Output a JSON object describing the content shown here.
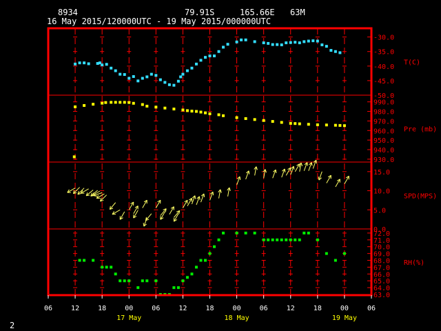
{
  "header": {
    "station": "8934",
    "lat": "79.91S",
    "lon": "165.66E",
    "elev": "63M",
    "period": "16 May 2015/120000UTC - 19 May 2015/000000UTC"
  },
  "footer_page": "2",
  "colors": {
    "frame": "#ff0000",
    "tick": "#ff0000",
    "axis_text": "#ff0000",
    "date_text": "#ffff00",
    "temperature": "#33ddff",
    "pressure": "#ffff00",
    "wind": "#ffff66",
    "humidity": "#00ee00"
  },
  "x_axis": {
    "range_hours": [
      -6,
      66
    ],
    "ticks": [
      {
        "h": -6,
        "label": "06"
      },
      {
        "h": 0,
        "label": "12"
      },
      {
        "h": 6,
        "label": "18"
      },
      {
        "h": 12,
        "label": "00"
      },
      {
        "h": 18,
        "label": "06"
      },
      {
        "h": 24,
        "label": "12"
      },
      {
        "h": 30,
        "label": "18"
      },
      {
        "h": 36,
        "label": "00"
      },
      {
        "h": 42,
        "label": "06"
      },
      {
        "h": 48,
        "label": "12"
      },
      {
        "h": 54,
        "label": "18"
      },
      {
        "h": 60,
        "label": "00"
      },
      {
        "h": 66,
        "label": "06"
      }
    ],
    "dates": [
      {
        "h": 12,
        "label": "17 May"
      },
      {
        "h": 36,
        "label": "18 May"
      },
      {
        "h": 60,
        "label": "19 May"
      }
    ]
  },
  "chart_data": [
    {
      "type": "scatter",
      "panel": "temperature",
      "ylabel": "T(C)",
      "ylim": [
        -50,
        -27
      ],
      "yticks": [
        -30.0,
        -35.0,
        -40.0,
        -45.0,
        -50.0
      ],
      "x": [
        0,
        1,
        2,
        3,
        5,
        5.5,
        6,
        7,
        8,
        9,
        10,
        11,
        12,
        13,
        14,
        15,
        16,
        17,
        18,
        19,
        20,
        21,
        22,
        23,
        23.5,
        24,
        25,
        26,
        27,
        28,
        29,
        30,
        31,
        32,
        33,
        34,
        36,
        37,
        38,
        40,
        42,
        43,
        44,
        45,
        46,
        47,
        48,
        49,
        50,
        51,
        52,
        53,
        54,
        55,
        56,
        57,
        58,
        59
      ],
      "y": [
        -39.3,
        -38.9,
        -38.9,
        -39.2,
        -39.1,
        -38.9,
        -39.6,
        -39.4,
        -40.7,
        -41.6,
        -42.8,
        -42.9,
        -44.2,
        -43.6,
        -45.1,
        -44.2,
        -43.7,
        -42.8,
        -43.2,
        -44.7,
        -45.6,
        -46.4,
        -46.6,
        -45.2,
        -43.7,
        -42.8,
        -41.6,
        -40.7,
        -39.3,
        -38.0,
        -37.0,
        -36.5,
        -36.5,
        -35.0,
        -33.5,
        -32.5,
        -31.7,
        -31.0,
        -31.0,
        -31.6,
        -32.0,
        -32.2,
        -32.6,
        -32.6,
        -32.7,
        -32.0,
        -31.9,
        -31.8,
        -32.0,
        -31.6,
        -31.4,
        -31.3,
        -31.4,
        -32.7,
        -33.2,
        -34.6,
        -35.0,
        -35.4
      ]
    },
    {
      "type": "scatter",
      "panel": "pressure",
      "ylabel": "Pre (mb)",
      "ylim": [
        927,
        997
      ],
      "yticks": [
        990.0,
        980.0,
        970.0,
        960.0,
        950.0,
        940.0,
        930.0
      ],
      "x": [
        -0.2,
        0,
        2,
        4,
        6,
        6.8,
        8,
        9,
        10,
        11,
        12,
        13,
        15,
        16,
        18,
        20,
        22,
        24,
        25,
        26,
        27,
        28,
        29,
        30,
        32,
        33,
        36,
        38,
        40,
        42,
        44,
        46,
        48,
        49,
        50,
        52,
        54,
        56,
        58,
        59,
        60
      ],
      "y": [
        932.5,
        984.8,
        986.2,
        987.5,
        988.6,
        989.3,
        989.5,
        989.5,
        989.5,
        989.5,
        989.3,
        988.5,
        987.2,
        985.5,
        984.5,
        983.5,
        982.5,
        981.5,
        980.8,
        980.3,
        980.0,
        979.3,
        978.5,
        977.5,
        976.5,
        975.5,
        973.5,
        972.5,
        971.5,
        970.5,
        969.5,
        968.5,
        967.5,
        967.3,
        967.0,
        966.5,
        966.0,
        965.8,
        965.5,
        965.3,
        965.1
      ]
    },
    {
      "type": "vector",
      "panel": "wind",
      "ylabel": "SPD(MPS)",
      "ylim": [
        0,
        17.5
      ],
      "yticks": [
        15.0,
        10.0,
        5.0,
        0.0
      ],
      "x": [
        0,
        1,
        2,
        3,
        4,
        5,
        5.5,
        6,
        6.5,
        7,
        9,
        10,
        11,
        12,
        13,
        14,
        15,
        16,
        17,
        18,
        19,
        20,
        21,
        22,
        23,
        24,
        25,
        26,
        27,
        28,
        30,
        32,
        34,
        36,
        38,
        40,
        42,
        44,
        46,
        47,
        48,
        49,
        50,
        51,
        52,
        53,
        55,
        56,
        58,
        60
      ],
      "y": [
        10.7,
        10.9,
        10.7,
        10.5,
        10.2,
        10.1,
        9.9,
        9.5,
        9.2,
        8.9,
        6.9,
        5.0,
        4.5,
        5.0,
        4.0,
        4.9,
        5.5,
        2.9,
        4.0,
        5.5,
        3.5,
        4.5,
        3.8,
        3.0,
        4.0,
        5.5,
        6.0,
        6.5,
        6.3,
        7.0,
        7.5,
        8.0,
        8.5,
        11.5,
        13.0,
        14.0,
        13.3,
        13.3,
        13.5,
        14.0,
        14.2,
        15.0,
        15.0,
        15.2,
        15.2,
        15.8,
        15.0,
        12.0,
        11.0,
        11.8
      ],
      "dir_deg": [
        240,
        225,
        225,
        240,
        230,
        230,
        240,
        250,
        240,
        225,
        220,
        240,
        210,
        30,
        30,
        210,
        30,
        200,
        220,
        30,
        40,
        210,
        30,
        40,
        210,
        30,
        30,
        20,
        20,
        20,
        20,
        10,
        10,
        20,
        20,
        10,
        10,
        20,
        20,
        30,
        20,
        30,
        10,
        20,
        20,
        20,
        200,
        30,
        30,
        30
      ]
    },
    {
      "type": "scatter",
      "panel": "humidity",
      "ylabel": "RH(%)",
      "ylim": [
        62.9,
        72.6
      ],
      "yticks": [
        72.0,
        71.0,
        70.0,
        69.0,
        68.0,
        67.0,
        66.0,
        65.0,
        64.0,
        63.0
      ],
      "x": [
        1,
        2,
        4,
        6,
        7,
        8,
        9,
        10,
        11,
        12,
        14,
        15,
        16,
        18,
        19,
        20,
        21,
        22,
        23,
        24,
        25,
        26,
        27,
        28,
        29,
        30,
        31,
        32,
        33,
        36,
        38,
        40,
        42,
        43,
        44,
        45,
        46,
        47,
        48,
        49,
        50,
        51,
        52,
        54,
        56,
        58,
        60
      ],
      "y": [
        68.0,
        68.0,
        68.0,
        67.0,
        67.0,
        67.0,
        66.0,
        65.0,
        65.0,
        65.0,
        64.0,
        65.0,
        65.0,
        65.0,
        63.0,
        63.0,
        63.0,
        64.0,
        64.0,
        65.0,
        65.5,
        66.0,
        67.0,
        68.0,
        68.0,
        69.0,
        70.0,
        71.0,
        72.0,
        72.0,
        72.0,
        72.0,
        71.0,
        71.0,
        71.0,
        71.0,
        71.0,
        71.0,
        71.0,
        71.0,
        71.0,
        72.0,
        72.0,
        71.0,
        69.0,
        68.0,
        69.0
      ]
    }
  ]
}
